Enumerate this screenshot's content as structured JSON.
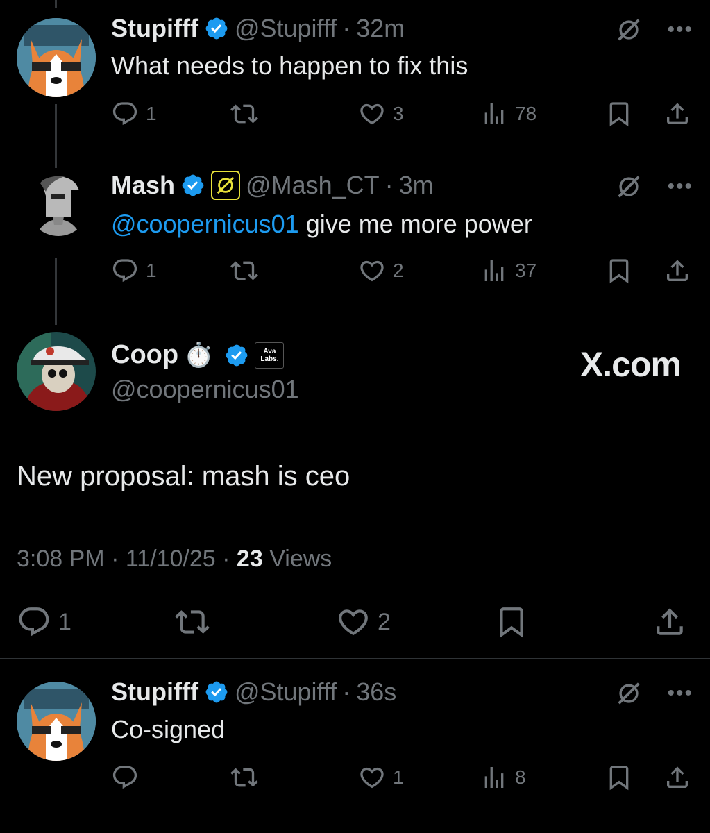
{
  "tweets": [
    {
      "name": "Stupifff",
      "handle": "@Stupifff",
      "dot": "·",
      "time": "32m",
      "text": "What needs to happen to fix this",
      "replies": "1",
      "retweets": "",
      "likes": "3",
      "views": "78",
      "avatar_icon": "corgi-avatar"
    },
    {
      "name": "Mash",
      "handle": "@Mash_CT",
      "dot": "·",
      "time": "3m",
      "mention": "@coopernicus01",
      "text": " give me more power",
      "replies": "1",
      "retweets": "",
      "likes": "2",
      "views": "37",
      "avatar_icon": "spartan-helmet-avatar"
    }
  ],
  "main": {
    "name": "Coop",
    "emoji": "⏱️",
    "affiliate_badge": "Ava\nLabs.",
    "handle": "@coopernicus01",
    "watermark": "X.com",
    "text": "New proposal: mash is ceo",
    "time": "3:08 PM",
    "date": "11/10/25",
    "views_count": "23",
    "views_label": "Views",
    "replies": "1",
    "likes": "2",
    "avatar_icon": "skull-cap-avatar"
  },
  "reply": {
    "name": "Stupifff",
    "handle": "@Stupifff",
    "dot": "·",
    "time": "36s",
    "text": "Co-signed",
    "replies": "",
    "likes": "1",
    "views": "8"
  },
  "colors": {
    "accent": "#1d9bf0",
    "muted": "#71767b",
    "text": "#e7e9ea",
    "background": "#000000"
  }
}
